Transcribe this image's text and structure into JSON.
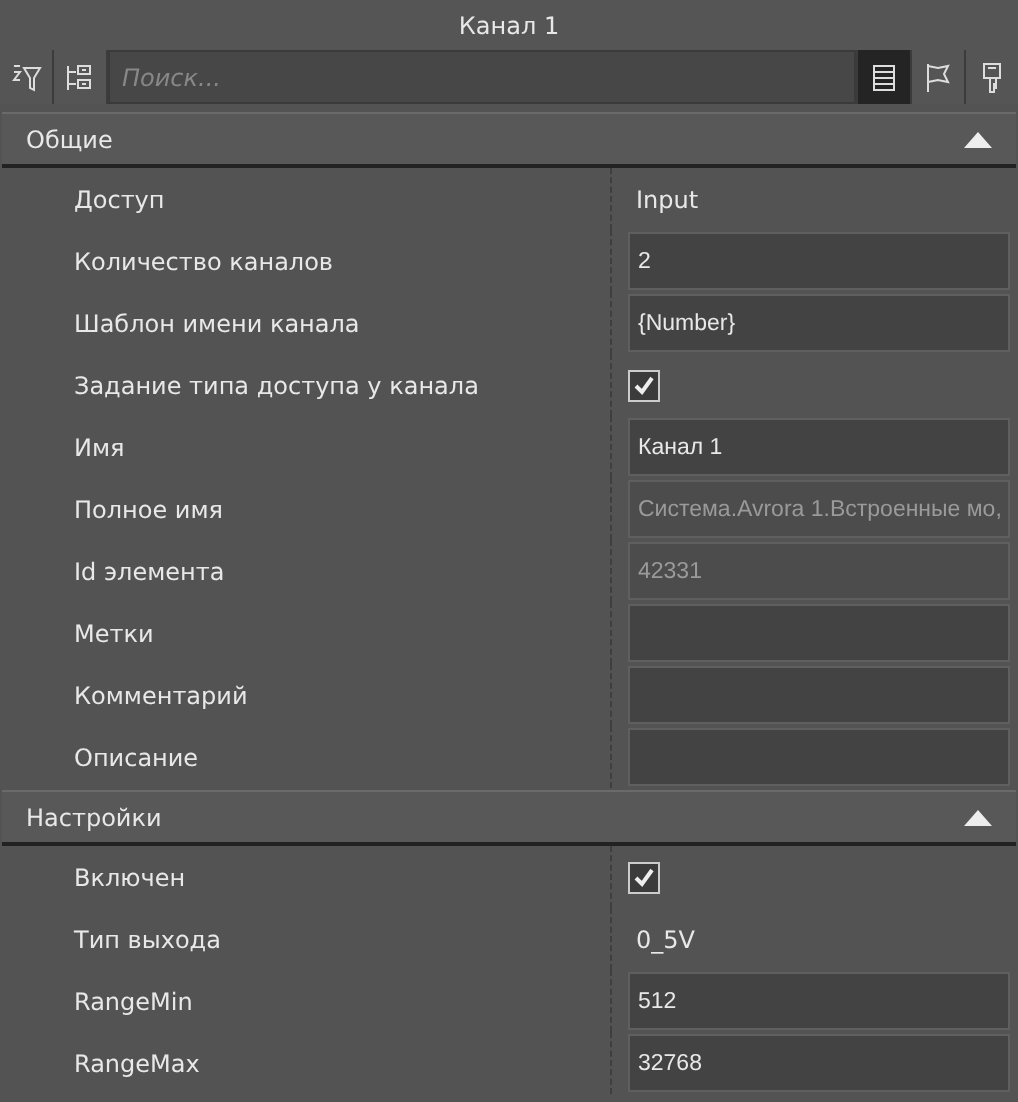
{
  "window": {
    "title": "Канал 1"
  },
  "toolbar": {
    "left_buttons": [
      {
        "kind": "sort-filter",
        "selected": false
      },
      {
        "kind": "tree",
        "selected": false
      }
    ],
    "search": {
      "placeholder": "Поиск..."
    },
    "right_buttons": [
      {
        "kind": "list",
        "selected": true
      },
      {
        "kind": "flag",
        "selected": false
      },
      {
        "kind": "key",
        "selected": false
      }
    ]
  },
  "sections": [
    {
      "title": "Общие",
      "expanded": true,
      "rows": [
        {
          "label": "Доступ",
          "kind": "text",
          "value": "Input"
        },
        {
          "label": "Количество каналов",
          "kind": "field",
          "value": "2",
          "disabled": false
        },
        {
          "label": "Шаблон имени канала",
          "kind": "field",
          "value": "{Number}",
          "disabled": false
        },
        {
          "label": "Задание типа доступа у канала",
          "kind": "checkbox",
          "checked": true
        },
        {
          "label": "Имя",
          "kind": "field",
          "value": "Канал 1",
          "disabled": false
        },
        {
          "label": "Полное имя",
          "kind": "field",
          "value": "Система.Avrora 1.Встроенные мо,",
          "disabled": true
        },
        {
          "label": "Id элемента",
          "kind": "field",
          "value": "42331",
          "disabled": true
        },
        {
          "label": "Метки",
          "kind": "field",
          "disabled": false
        },
        {
          "label": "Комментарий",
          "kind": "field",
          "disabled": false
        },
        {
          "label": "Описание",
          "kind": "field",
          "disabled": false
        }
      ]
    },
    {
      "title": "Настройки",
      "expanded": true,
      "rows": [
        {
          "label": "Включен",
          "kind": "checkbox",
          "checked": true
        },
        {
          "label": "Тип выхода",
          "kind": "text",
          "value": "0_5V"
        },
        {
          "label": "RangeMin",
          "kind": "field",
          "value": "512",
          "disabled": false
        },
        {
          "label": "RangeMax",
          "kind": "field",
          "value": "32768",
          "disabled": false
        }
      ]
    }
  ]
}
